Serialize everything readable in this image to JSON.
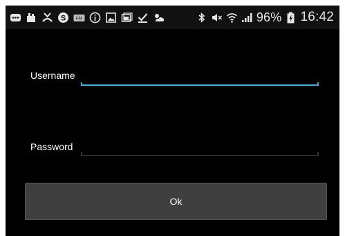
{
  "status_bar": {
    "left_icons": [
      "bbm-icon",
      "notification-icon",
      "missed-call-icon",
      "skype-icon",
      "fm-radio-icon",
      "info-icon",
      "image-icon",
      "gallery-icon",
      "download-done-icon",
      "weather-icon"
    ],
    "right_icons": [
      "bluetooth-icon",
      "mute-icon",
      "wifi-icon",
      "signal-icon",
      "battery-icon"
    ],
    "battery": "96%",
    "time": "16:42"
  },
  "form": {
    "username_label": "Username",
    "username_value": "",
    "password_label": "Password",
    "password_value": "",
    "ok_label": "Ok"
  },
  "colors": {
    "background": "#000000",
    "accent": "#33b5e5",
    "button": "#3f3f3f"
  }
}
